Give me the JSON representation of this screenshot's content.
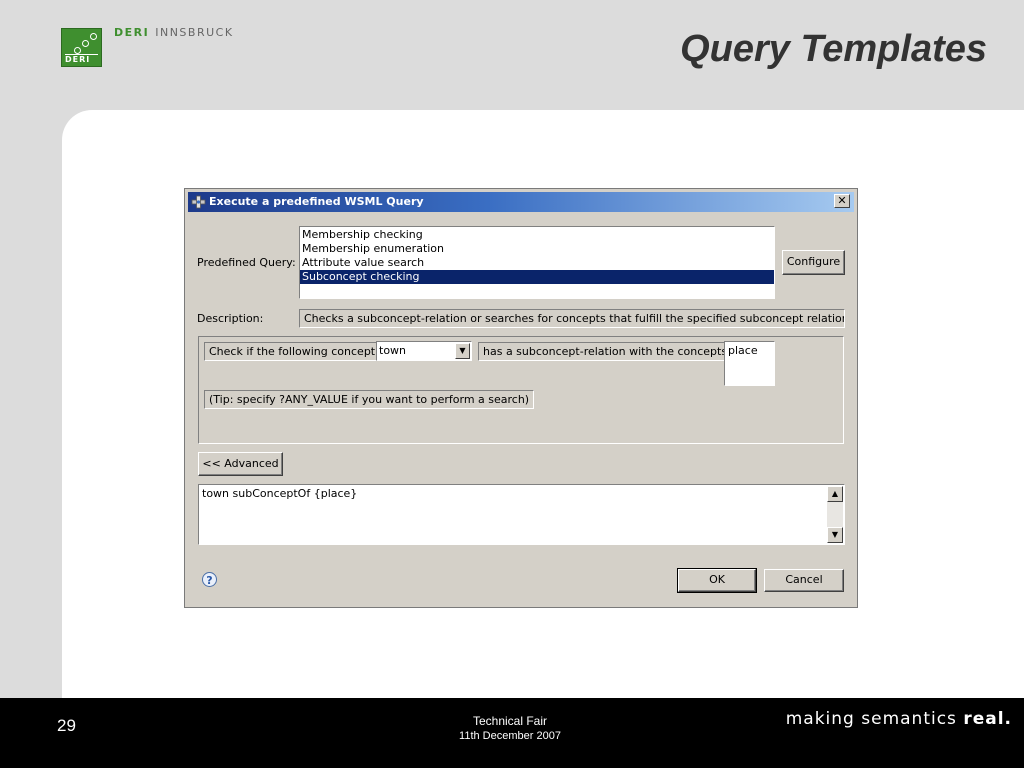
{
  "header": {
    "logo_text": "DERI",
    "brand_primary": "DERI",
    "brand_secondary": "INNSBRUCK",
    "slide_title": "Query Templates"
  },
  "dialog": {
    "title": "Execute a predefined WSML Query",
    "close_glyph": "✕",
    "predefined_label": "Predefined Query:",
    "queries": [
      {
        "label": "Membership checking",
        "selected": false
      },
      {
        "label": "Membership enumeration",
        "selected": false
      },
      {
        "label": "Attribute value search",
        "selected": false
      },
      {
        "label": "Subconcept checking",
        "selected": true
      }
    ],
    "configure_label": "Configure",
    "description_label": "Description:",
    "description_text": "Checks a subconcept-relation or searches for concepts that fulfill the specified subconcept relationship",
    "check_label": "Check if the following concept:",
    "concept_value": "town",
    "relation_label": "has a subconcept-relation with the concepts:",
    "concepts_value": "place",
    "tip_text": "(Tip: specify ?ANY_VALUE if you want to perform a search)",
    "advanced_label": "<< Advanced",
    "query_text": "town subConceptOf {place}",
    "help_glyph": "?",
    "ok_label": "OK",
    "cancel_label": "Cancel"
  },
  "footer": {
    "page_number": "29",
    "event_name": "Technical Fair",
    "event_date": "11th December 2007",
    "tagline_plain": "making semantics ",
    "tagline_bold": "real."
  },
  "colors": {
    "slide_background": "#dcdcdc",
    "footer_background": "#000000",
    "deri_green": "#3f8f2f",
    "selection_blue": "#0a246a",
    "dialog_gray": "#d4d0c8"
  }
}
